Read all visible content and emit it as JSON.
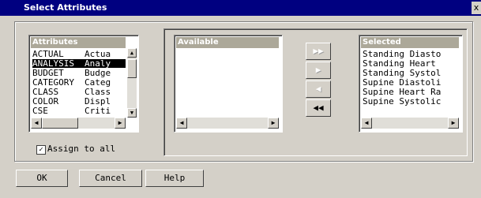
{
  "window": {
    "title": "Select Attributes",
    "close_glyph": "x"
  },
  "attributes": {
    "header": "Attributes",
    "rows": [
      {
        "name": "ACTUAL",
        "desc": "Actua"
      },
      {
        "name": "ANALYSIS",
        "desc": "Analy"
      },
      {
        "name": "BUDGET",
        "desc": "Budge"
      },
      {
        "name": "CATEGORY",
        "desc": "Categ"
      },
      {
        "name": "CLASS",
        "desc": "Class"
      },
      {
        "name": "COLOR",
        "desc": "Displ"
      },
      {
        "name": "CSE",
        "desc": "Criti"
      }
    ],
    "selected_index": 1
  },
  "available": {
    "header": "Available"
  },
  "selected": {
    "header": "Selected",
    "rows": [
      "Standing Diasto",
      "Standing Heart ",
      "Standing Systol",
      "Supine Diastoli",
      "Supine Heart Ra",
      "Supine Systolic"
    ]
  },
  "assign_all": {
    "label": "Assign to all",
    "checked": true,
    "mark": "✓"
  },
  "buttons": {
    "ok": "OK",
    "cancel": "Cancel",
    "help": "Help"
  },
  "move_buttons": [
    {
      "name": "add-all-button",
      "icon": "double-right-icon",
      "glyph": "▶▶",
      "enabled": false
    },
    {
      "name": "add-button",
      "icon": "right-icon",
      "glyph": "▶",
      "enabled": false
    },
    {
      "name": "remove-button",
      "icon": "left-icon",
      "glyph": "◀",
      "enabled": false
    },
    {
      "name": "remove-all-button",
      "icon": "double-left-icon",
      "glyph": "◀◀",
      "enabled": true
    }
  ],
  "scroll_glyphs": {
    "left": "◀",
    "right": "▶",
    "up": "▲",
    "down": "▼"
  }
}
